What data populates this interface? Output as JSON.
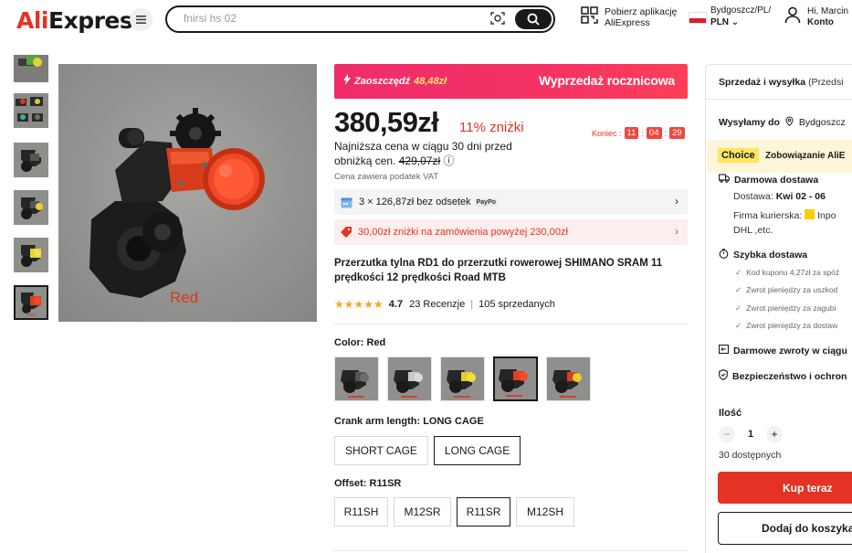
{
  "header": {
    "logo": "AliExpress",
    "search_placeholder": "fnirsi hs 02",
    "app_promo_line1": "Pobierz aplikację",
    "app_promo_line2": "AliExpress",
    "region_line1": "Bydgoszcz/PL/",
    "region_line2": "PLN",
    "account_line1": "Hi, Marcin",
    "account_line2": "Konto"
  },
  "gallery": {
    "thumb_count": 6,
    "selected_thumb": 6,
    "main_label": "Red"
  },
  "promo": {
    "save_label": "Zaoszczędź",
    "save_amount": "48,48zł",
    "event": "Wyprzedaż rocznicowa"
  },
  "price": {
    "current": "380,59zł",
    "discount": "11% zniżki",
    "countdown_label": "Koniec :",
    "countdown": [
      "11",
      "04",
      "29"
    ],
    "lowest_text": "Najniższa cena w ciągu 30 dni przed obniżką cen.",
    "lowest_old_price": "429,07zł",
    "vat": "Cena zawiera podatek VAT"
  },
  "installment": {
    "text": "3 × 126,87zł bez odsetek",
    "provider": "PayPo"
  },
  "coupon": {
    "text": "30,00zł zniżki na zamówienia powyżej 230,00zł"
  },
  "product": {
    "title": "Przerzutka tylna RD1 do przerzutki rowerowej SHIMANO SRAM 11 prędkości 12 prędkości Road MTB",
    "rating": "4.7",
    "reviews": "23 Recenzje",
    "sold": "105 sprzedanych"
  },
  "variants": {
    "color_label": "Color:",
    "color_value": "Red",
    "color_count": 5,
    "color_selected": 4,
    "crank_label": "Crank arm length:",
    "crank_value": "LONG CAGE",
    "crank_options": [
      "SHORT CAGE",
      "LONG CAGE"
    ],
    "offset_label": "Offset:",
    "offset_value": "R11SR",
    "offset_options": [
      "R11SH",
      "M12SR",
      "R11SR",
      "M12SH"
    ]
  },
  "panel": {
    "header_bold": "Sprzedaż i wysyłka",
    "header_rest": "(Przedsi",
    "ship_to_label": "Wysyłamy do",
    "ship_to_city": "Bydgoszcz",
    "choice_tag": "Choice",
    "choice_text": "Zobowiązanie AliE",
    "free_delivery": "Darmowa dostawa",
    "delivery_label": "Dostawa:",
    "delivery_date": "Kwi 02 - 06",
    "courier_label": "Firma kurierska:",
    "courier_value": "Inpo",
    "courier_more": "DHL ,etc.",
    "fast_delivery": "Szybka dostawa",
    "checks": [
      "Kod kuponu 4,27zł za spóź",
      "Zwrot pieniędzy za uszkod",
      "Zwrot pieniędzy za zagubi",
      "Zwrot pieniędzy za dostaw"
    ],
    "free_returns": "Darmowe zwroty w ciągu",
    "security": "Bezpieczeństwo i ochron",
    "qty_label": "Ilość",
    "qty_value": "1",
    "available": "30 dostępnych",
    "buy_now": "Kup teraz",
    "add_to_cart": "Dodaj do koszyka"
  },
  "colors": {
    "brand_red": "#e43225",
    "promo_pink": "#f53264",
    "choice_yellow": "#fee55e",
    "star": "#f5a623"
  }
}
